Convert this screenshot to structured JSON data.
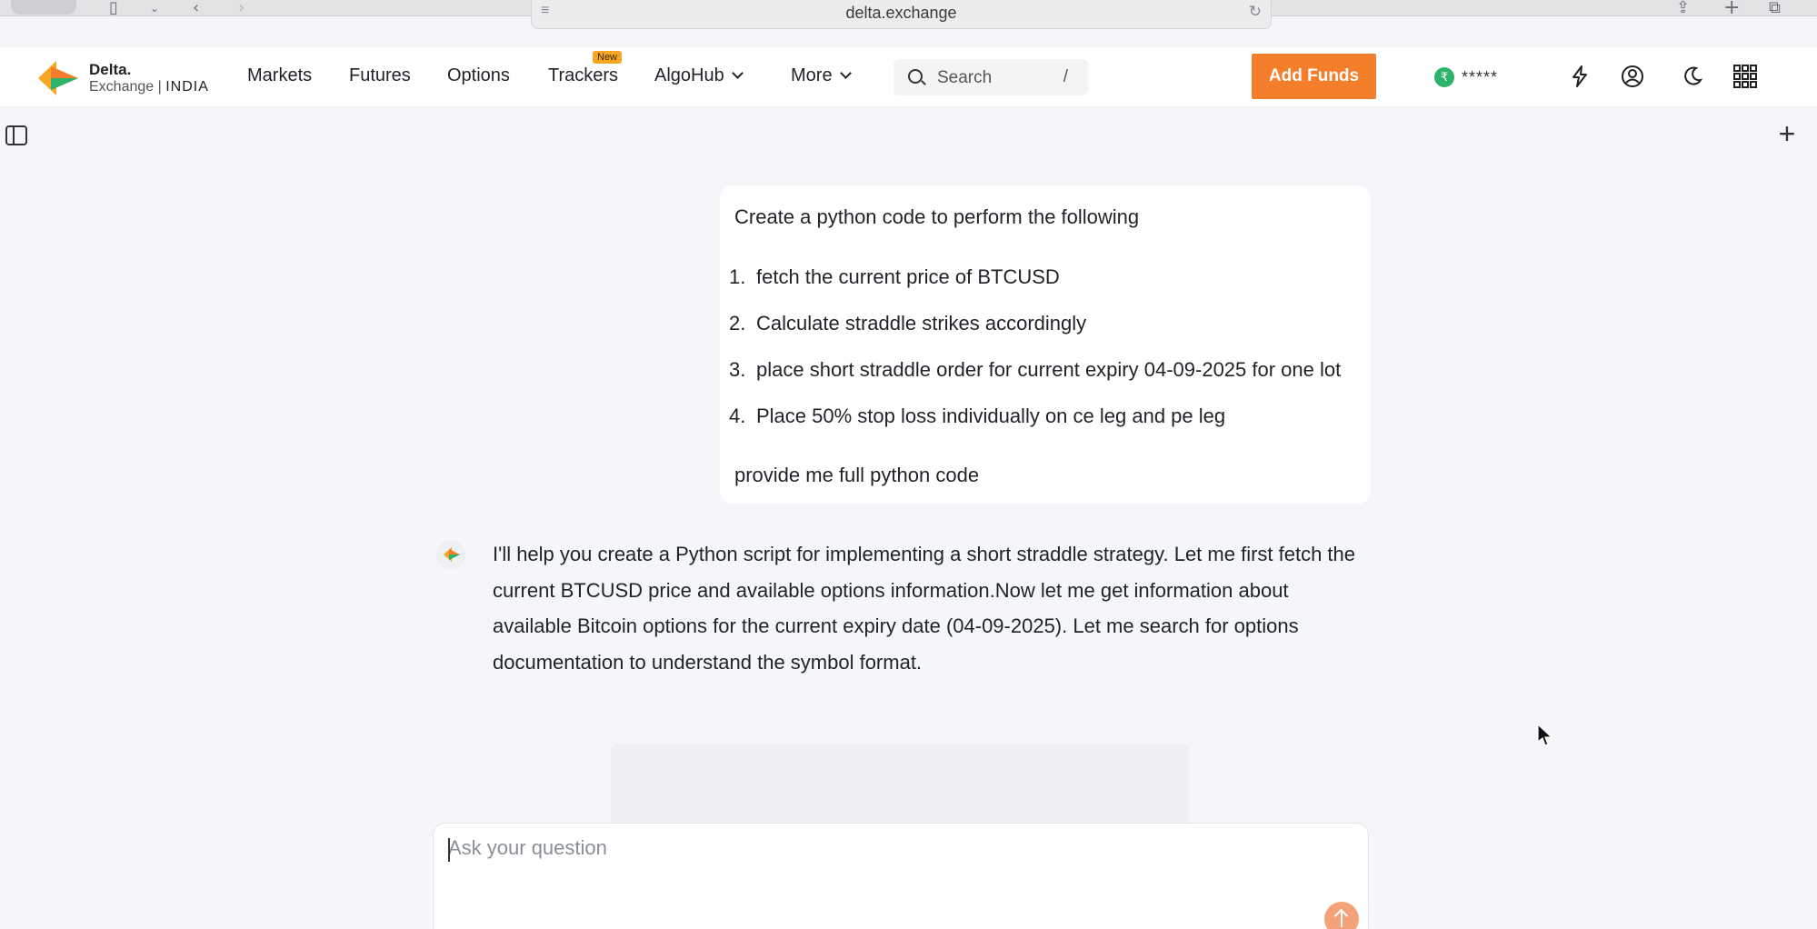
{
  "browser": {
    "url": "delta.exchange"
  },
  "logo": {
    "line1": "Delta.",
    "line2_prefix": "Exchange |",
    "line2_region": "INDIA"
  },
  "nav": {
    "items": [
      {
        "label": "Markets"
      },
      {
        "label": "Futures"
      },
      {
        "label": "Options"
      },
      {
        "label": "Trackers",
        "badge": "New"
      },
      {
        "label": "AlgoHub"
      },
      {
        "label": "More"
      }
    ],
    "search": {
      "placeholder": "Search",
      "shortcut": "/"
    },
    "add_funds_label": "Add Funds",
    "balance_masked": "*****"
  },
  "conversation": {
    "user_message": {
      "intro": "Create a python code to perform the following",
      "steps": [
        {
          "num": "1.",
          "text": "fetch the current price of BTCUSD"
        },
        {
          "num": "2.",
          "text": "Calculate straddle strikes accordingly"
        },
        {
          "num": "3.",
          "text": "place short straddle order for current expiry 04-09-2025 for one lot"
        },
        {
          "num": "4.",
          "text": "Place 50% stop loss individually on ce leg and pe leg"
        }
      ],
      "outro": "provide me full python code"
    },
    "assistant_message": {
      "text": "I'll help you create a Python script for implementing a short straddle strategy. Let me first fetch the current BTCUSD price and available options information.Now let me get information about available Bitcoin options for the current expiry date (04-09-2025). Let me search for options documentation to understand the symbol format."
    }
  },
  "composer": {
    "placeholder": "Ask your question"
  },
  "colors": {
    "accent": "#f47e2a",
    "background": "#f4f6f9",
    "balance_icon": "#2fb36b"
  }
}
